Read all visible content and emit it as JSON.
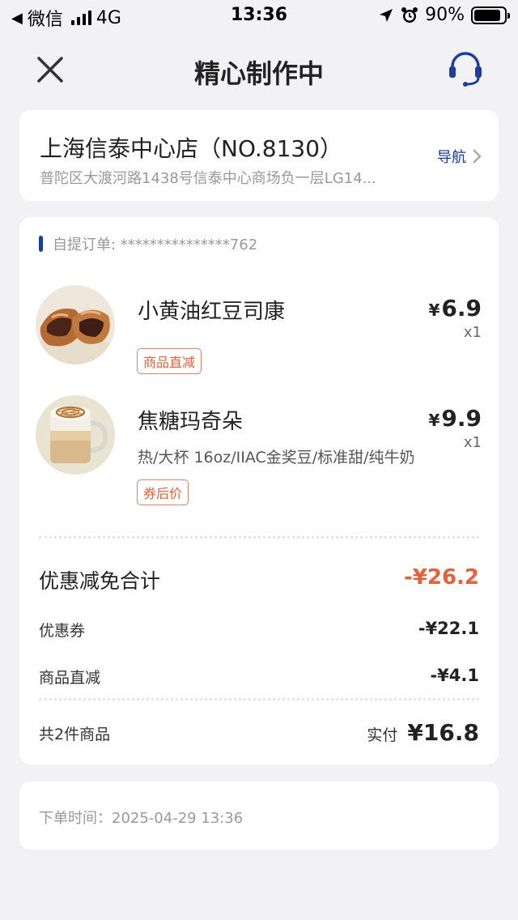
{
  "status_bar": {
    "carrier": "微信",
    "network": "4G",
    "time": "13:36",
    "battery": "90%",
    "battery_level": 0.9
  },
  "header": {
    "title": "精心制作中"
  },
  "store": {
    "name": "上海信泰中心店（NO.8130）",
    "address": "普陀区大渡河路1438号信泰中心商场负一层LG14...",
    "nav_label": "导航"
  },
  "order": {
    "type_label": "自提订单: ***************762",
    "items": [
      {
        "name": "小黄油红豆司康",
        "spec": "",
        "tag": "商品直减",
        "price_currency": "¥",
        "price": "6.9",
        "qty": "x1"
      },
      {
        "name": "焦糖玛奇朵",
        "spec": "热/大杯 16oz/IIAC金奖豆/标准甜/纯牛奶",
        "tag": "券后价",
        "price_currency": "¥",
        "price": "9.9",
        "qty": "x1"
      }
    ],
    "discount_total_label": "优惠减免合计",
    "discount_total_value": "-¥26.2",
    "coupon_label": "优惠券",
    "coupon_value": "-¥22.1",
    "direct_label": "商品直减",
    "direct_value": "-¥4.1",
    "count_label": "共2件商品",
    "paid_label": "实付",
    "paid_value": "¥16.8"
  },
  "order_time": "下单时间：2025-04-29 13:36",
  "colors": {
    "accent_blue": "#1e3d9a",
    "discount_red": "#e0633f",
    "background": "#f2f2f4"
  },
  "icons": {
    "close": "close-icon",
    "support": "headset-icon",
    "nav": "chevron-right-icon"
  }
}
